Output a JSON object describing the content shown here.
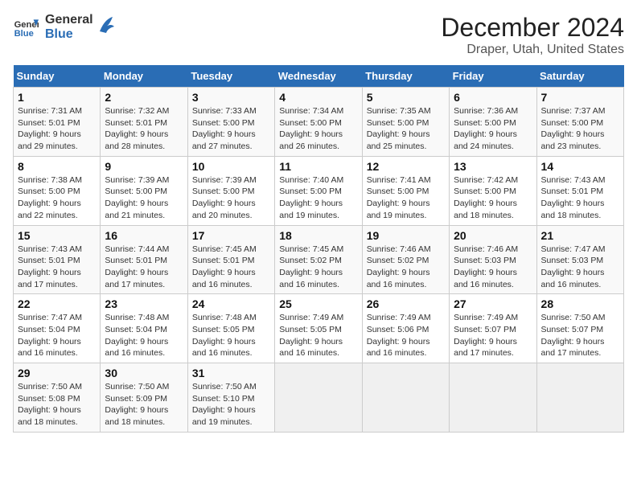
{
  "header": {
    "logo_line1": "General",
    "logo_line2": "Blue",
    "main_title": "December 2024",
    "subtitle": "Draper, Utah, United States"
  },
  "calendar": {
    "weekdays": [
      "Sunday",
      "Monday",
      "Tuesday",
      "Wednesday",
      "Thursday",
      "Friday",
      "Saturday"
    ],
    "weeks": [
      [
        {
          "day": "1",
          "info": "Sunrise: 7:31 AM\nSunset: 5:01 PM\nDaylight: 9 hours\nand 29 minutes."
        },
        {
          "day": "2",
          "info": "Sunrise: 7:32 AM\nSunset: 5:01 PM\nDaylight: 9 hours\nand 28 minutes."
        },
        {
          "day": "3",
          "info": "Sunrise: 7:33 AM\nSunset: 5:00 PM\nDaylight: 9 hours\nand 27 minutes."
        },
        {
          "day": "4",
          "info": "Sunrise: 7:34 AM\nSunset: 5:00 PM\nDaylight: 9 hours\nand 26 minutes."
        },
        {
          "day": "5",
          "info": "Sunrise: 7:35 AM\nSunset: 5:00 PM\nDaylight: 9 hours\nand 25 minutes."
        },
        {
          "day": "6",
          "info": "Sunrise: 7:36 AM\nSunset: 5:00 PM\nDaylight: 9 hours\nand 24 minutes."
        },
        {
          "day": "7",
          "info": "Sunrise: 7:37 AM\nSunset: 5:00 PM\nDaylight: 9 hours\nand 23 minutes."
        }
      ],
      [
        {
          "day": "8",
          "info": "Sunrise: 7:38 AM\nSunset: 5:00 PM\nDaylight: 9 hours\nand 22 minutes."
        },
        {
          "day": "9",
          "info": "Sunrise: 7:39 AM\nSunset: 5:00 PM\nDaylight: 9 hours\nand 21 minutes."
        },
        {
          "day": "10",
          "info": "Sunrise: 7:39 AM\nSunset: 5:00 PM\nDaylight: 9 hours\nand 20 minutes."
        },
        {
          "day": "11",
          "info": "Sunrise: 7:40 AM\nSunset: 5:00 PM\nDaylight: 9 hours\nand 19 minutes."
        },
        {
          "day": "12",
          "info": "Sunrise: 7:41 AM\nSunset: 5:00 PM\nDaylight: 9 hours\nand 19 minutes."
        },
        {
          "day": "13",
          "info": "Sunrise: 7:42 AM\nSunset: 5:00 PM\nDaylight: 9 hours\nand 18 minutes."
        },
        {
          "day": "14",
          "info": "Sunrise: 7:43 AM\nSunset: 5:01 PM\nDaylight: 9 hours\nand 18 minutes."
        }
      ],
      [
        {
          "day": "15",
          "info": "Sunrise: 7:43 AM\nSunset: 5:01 PM\nDaylight: 9 hours\nand 17 minutes."
        },
        {
          "day": "16",
          "info": "Sunrise: 7:44 AM\nSunset: 5:01 PM\nDaylight: 9 hours\nand 17 minutes."
        },
        {
          "day": "17",
          "info": "Sunrise: 7:45 AM\nSunset: 5:01 PM\nDaylight: 9 hours\nand 16 minutes."
        },
        {
          "day": "18",
          "info": "Sunrise: 7:45 AM\nSunset: 5:02 PM\nDaylight: 9 hours\nand 16 minutes."
        },
        {
          "day": "19",
          "info": "Sunrise: 7:46 AM\nSunset: 5:02 PM\nDaylight: 9 hours\nand 16 minutes."
        },
        {
          "day": "20",
          "info": "Sunrise: 7:46 AM\nSunset: 5:03 PM\nDaylight: 9 hours\nand 16 minutes."
        },
        {
          "day": "21",
          "info": "Sunrise: 7:47 AM\nSunset: 5:03 PM\nDaylight: 9 hours\nand 16 minutes."
        }
      ],
      [
        {
          "day": "22",
          "info": "Sunrise: 7:47 AM\nSunset: 5:04 PM\nDaylight: 9 hours\nand 16 minutes."
        },
        {
          "day": "23",
          "info": "Sunrise: 7:48 AM\nSunset: 5:04 PM\nDaylight: 9 hours\nand 16 minutes."
        },
        {
          "day": "24",
          "info": "Sunrise: 7:48 AM\nSunset: 5:05 PM\nDaylight: 9 hours\nand 16 minutes."
        },
        {
          "day": "25",
          "info": "Sunrise: 7:49 AM\nSunset: 5:05 PM\nDaylight: 9 hours\nand 16 minutes."
        },
        {
          "day": "26",
          "info": "Sunrise: 7:49 AM\nSunset: 5:06 PM\nDaylight: 9 hours\nand 16 minutes."
        },
        {
          "day": "27",
          "info": "Sunrise: 7:49 AM\nSunset: 5:07 PM\nDaylight: 9 hours\nand 17 minutes."
        },
        {
          "day": "28",
          "info": "Sunrise: 7:50 AM\nSunset: 5:07 PM\nDaylight: 9 hours\nand 17 minutes."
        }
      ],
      [
        {
          "day": "29",
          "info": "Sunrise: 7:50 AM\nSunset: 5:08 PM\nDaylight: 9 hours\nand 18 minutes."
        },
        {
          "day": "30",
          "info": "Sunrise: 7:50 AM\nSunset: 5:09 PM\nDaylight: 9 hours\nand 18 minutes."
        },
        {
          "day": "31",
          "info": "Sunrise: 7:50 AM\nSunset: 5:10 PM\nDaylight: 9 hours\nand 19 minutes."
        },
        {
          "day": "",
          "info": ""
        },
        {
          "day": "",
          "info": ""
        },
        {
          "day": "",
          "info": ""
        },
        {
          "day": "",
          "info": ""
        }
      ]
    ]
  }
}
